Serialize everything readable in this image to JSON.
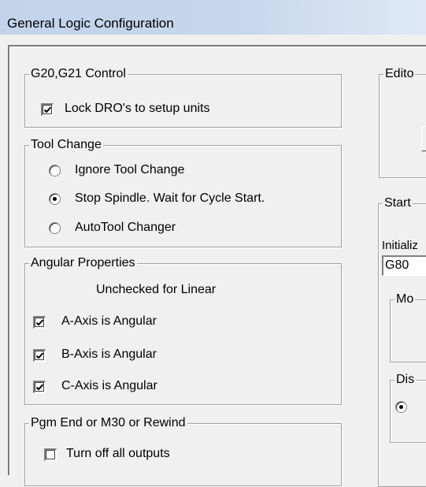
{
  "window": {
    "title": "General Logic Configuration"
  },
  "g20g21": {
    "legend": "G20,G21 Control",
    "lock_dro_label": "Lock DRO's to setup units",
    "lock_dro_checked": true
  },
  "tool_change": {
    "legend": "Tool Change",
    "options": [
      {
        "label": "Ignore Tool Change",
        "selected": false
      },
      {
        "label": "Stop Spindle. Wait for Cycle Start.",
        "selected": true
      },
      {
        "label": "AutoTool Changer",
        "selected": false
      }
    ]
  },
  "angular": {
    "legend": "Angular Properties",
    "subtitle": "Unchecked for Linear",
    "axes": [
      {
        "label": "A-Axis is Angular",
        "checked": true
      },
      {
        "label": "B-Axis is Angular",
        "checked": true
      },
      {
        "label": "C-Axis is Angular",
        "checked": true
      }
    ]
  },
  "pgm_end": {
    "legend": "Pgm End or M30 or Rewind",
    "items": [
      {
        "label": "Turn off all outputs",
        "checked": false
      }
    ]
  },
  "right": {
    "editor_legend": "Edito",
    "startup_legend": "Start",
    "init_label": "Initializ",
    "init_value": "G80",
    "mo_legend": "Mo",
    "dis_legend": "Dis"
  }
}
